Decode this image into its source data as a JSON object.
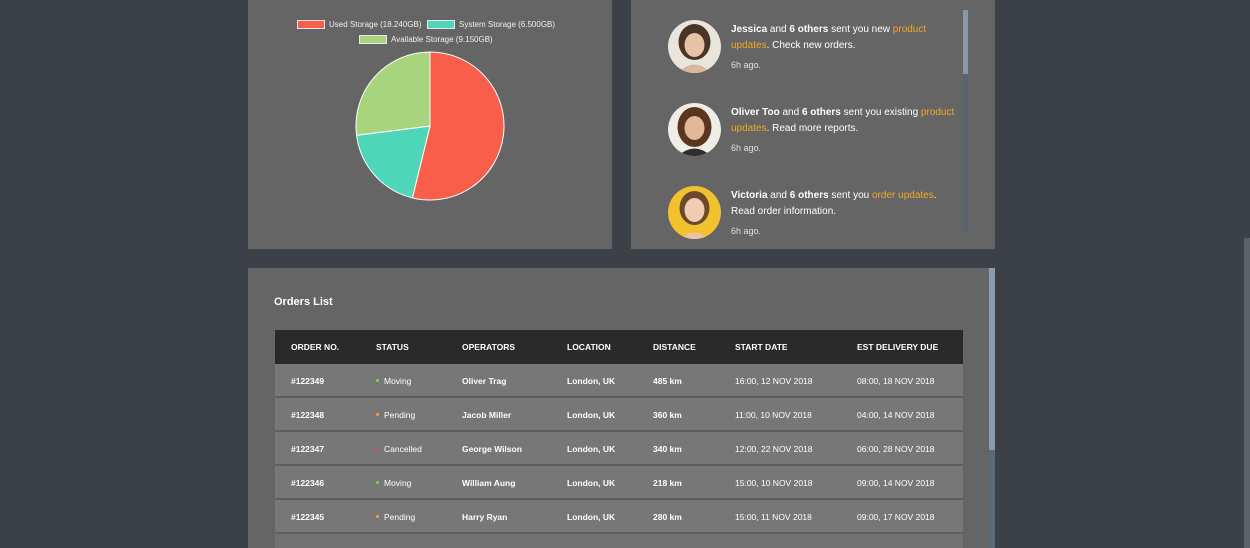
{
  "storage_chart": {
    "chart_data": {
      "type": "pie",
      "labels": [
        "Used Storage (18.240GB)",
        "System Storage (6.500GB)",
        "Available Storage (9.150GB)"
      ],
      "values": [
        18.24,
        6.5,
        9.15
      ],
      "colors": [
        "#f95e4b",
        "#4dd7b8",
        "#a8d47e"
      ],
      "legend_position": "top"
    }
  },
  "notifications": [
    {
      "name": "Jessica",
      "middle": " and ",
      "others": "6 others",
      "pre_link": " sent you new ",
      "link": "product updates",
      "post_link": ". Check new orders.",
      "time": "6h ago."
    },
    {
      "name": "Oliver Too",
      "middle": " and ",
      "others": "6 others",
      "pre_link": " sent you existing ",
      "link": "product updates",
      "post_link": ". Read more reports.",
      "time": "6h ago."
    },
    {
      "name": "Victoria",
      "middle": " and ",
      "others": "6 others",
      "pre_link": " sent you ",
      "link": "order updates",
      "post_link": ". Read order information.",
      "time": "6h ago."
    }
  ],
  "orders": {
    "title": "Orders List",
    "columns": [
      "ORDER NO.",
      "STATUS",
      "OPERATORS",
      "LOCATION",
      "DISTANCE",
      "START DATE",
      "EST DELIVERY DUE"
    ],
    "rows": [
      {
        "order": "#122349",
        "status": "Moving",
        "operator": "Oliver Trag",
        "location": "London, UK",
        "distance": "485 km",
        "start": "16:00, 12 NOV 2018",
        "due": "08:00, 18 NOV 2018"
      },
      {
        "order": "#122348",
        "status": "Pending",
        "operator": "Jacob Miller",
        "location": "London, UK",
        "distance": "360 km",
        "start": "11:00, 10 NOV 2018",
        "due": "04:00, 14 NOV 2018"
      },
      {
        "order": "#122347",
        "status": "Cancelled",
        "operator": "George Wilson",
        "location": "London, UK",
        "distance": "340 km",
        "start": "12:00, 22 NOV 2018",
        "due": "06:00, 28 NOV 2018"
      },
      {
        "order": "#122346",
        "status": "Moving",
        "operator": "William Aung",
        "location": "London, UK",
        "distance": "218 km",
        "start": "15:00, 10 NOV 2018",
        "due": "09:00, 14 NOV 2018"
      },
      {
        "order": "#122345",
        "status": "Pending",
        "operator": "Harry Ryan",
        "location": "London, UK",
        "distance": "280 km",
        "start": "15:00, 11 NOV 2018",
        "due": "09:00, 17 NOV 2018"
      }
    ],
    "status_colors": {
      "Moving": "#7cd35b",
      "Pending": "#f5a623",
      "Cancelled": "#e84c3d"
    }
  }
}
